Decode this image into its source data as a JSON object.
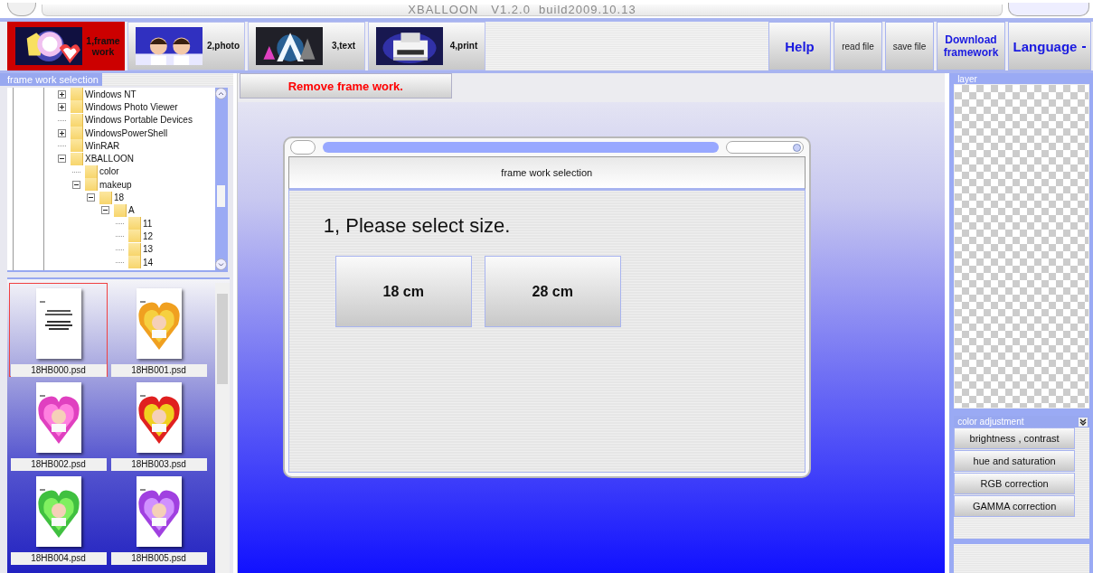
{
  "window": {
    "title": "XBALLOON   V1.2.0  build2009.10.13"
  },
  "tabs": [
    {
      "label": "1,frame work",
      "selected": true
    },
    {
      "label": "2,photo",
      "selected": false
    },
    {
      "label": "3,text",
      "selected": false
    },
    {
      "label": "4,print",
      "selected": false
    }
  ],
  "toolbar_buttons": [
    {
      "label": "Help",
      "kind": "large"
    },
    {
      "label": "read file",
      "kind": "small"
    },
    {
      "label": "save file",
      "kind": "small"
    },
    {
      "label": "Download framework",
      "kind": "medium"
    },
    {
      "label": "Language",
      "kind": "dropdown"
    }
  ],
  "left_panel": {
    "title": "frame work selection",
    "tree": [
      {
        "label": "Windows NT",
        "expandable": true,
        "expanded": false
      },
      {
        "label": "Windows Photo Viewer",
        "expandable": true,
        "expanded": false
      },
      {
        "label": "Windows Portable Devices",
        "expandable": false
      },
      {
        "label": "WindowsPowerShell",
        "expandable": true,
        "expanded": false
      },
      {
        "label": "WinRAR",
        "expandable": false
      },
      {
        "label": "XBALLOON",
        "expandable": true,
        "expanded": true,
        "children": [
          {
            "label": "color",
            "expandable": false
          },
          {
            "label": "makeup",
            "expandable": true,
            "expanded": true,
            "children": [
              {
                "label": "18",
                "expandable": true,
                "expanded": true,
                "children": [
                  {
                    "label": "A",
                    "expandable": true,
                    "expanded": true,
                    "children": [
                      {
                        "label": "11",
                        "expandable": false
                      },
                      {
                        "label": "12",
                        "expandable": false
                      },
                      {
                        "label": "13",
                        "expandable": false
                      },
                      {
                        "label": "14",
                        "expandable": false
                      }
                    ]
                  }
                ]
              }
            ]
          }
        ]
      }
    ],
    "thumbnails": [
      {
        "label": "18HB000.psd",
        "kind": "document",
        "selected": true
      },
      {
        "label": "18HB001.psd",
        "kind": "heart",
        "selected": false
      },
      {
        "label": "18HB002.psd",
        "kind": "heart",
        "selected": false
      },
      {
        "label": "18HB003.psd",
        "kind": "heart",
        "selected": false
      },
      {
        "label": "18HB004.psd",
        "kind": "heart",
        "selected": false
      },
      {
        "label": "18HB005.psd",
        "kind": "heart",
        "selected": false
      }
    ]
  },
  "center": {
    "remove_button": "Remove frame work.",
    "dialog": {
      "title": "frame work selection",
      "prompt": "1, Please select size.",
      "sizes": [
        "18 cm",
        "28 cm"
      ]
    }
  },
  "right_panel": {
    "layer_title": "layer",
    "color_adjustment": {
      "title": "color adjustment",
      "buttons": [
        "brightness , contrast",
        "hue and saturation",
        "RGB correction",
        "GAMMA correction"
      ]
    }
  }
}
